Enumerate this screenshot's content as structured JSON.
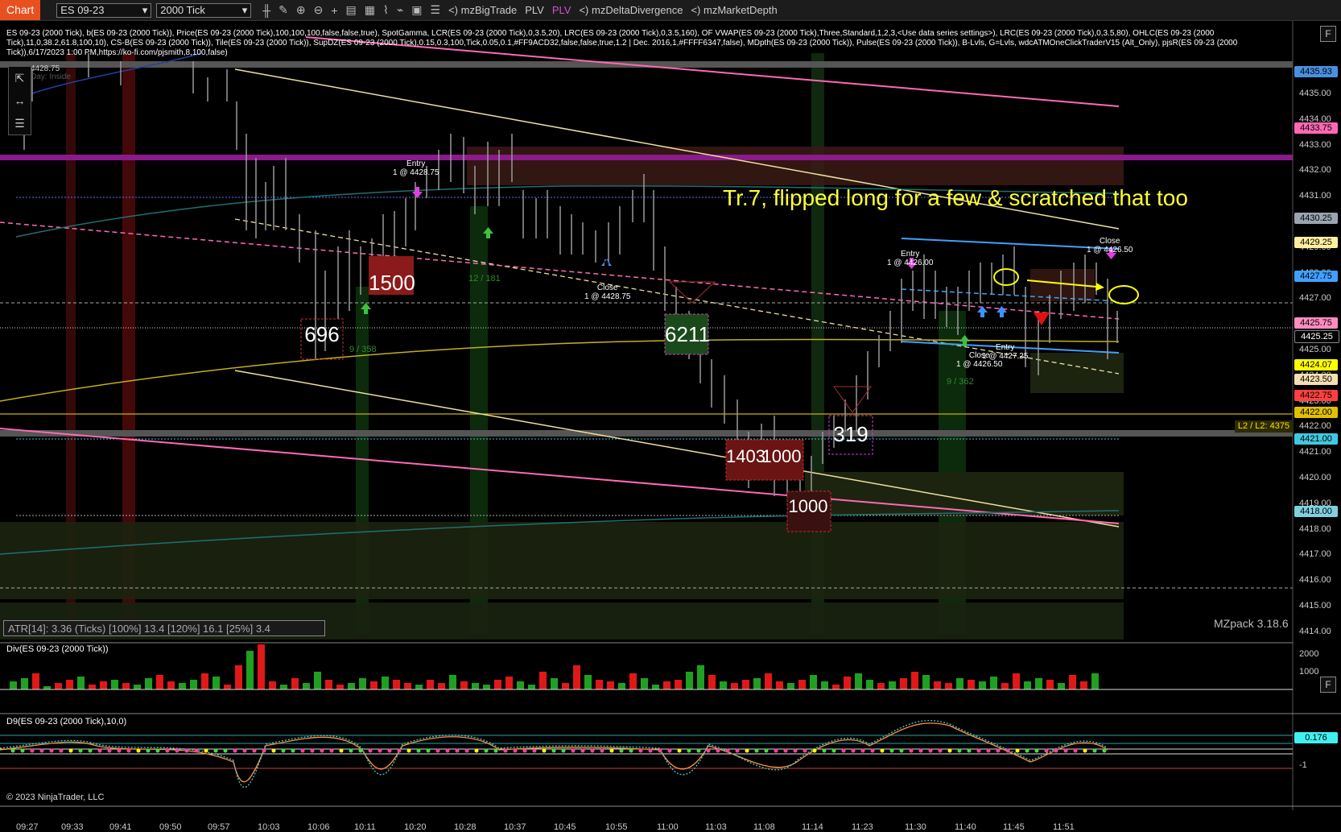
{
  "toolbar": {
    "chart_tab": "Chart",
    "instrument": "ES 09-23",
    "interval": "2000 Tick",
    "items": [
      "mzBigTrade",
      "PLV",
      "PLV",
      "mzDeltaDivergence",
      "mzMarketDepth"
    ]
  },
  "indicators_text": "ES 09-23 (2000 Tick), b(ES 09-23 (2000 Tick)), Price(ES 09-23 (2000 Tick),100,100,100,false,false,true), SpotGamma, LCR(ES 09-23 (2000 Tick),0,3.5,20), LRC(ES 09-23 (2000 Tick),0,3.5,160), OF VWAP(ES 09-23 (2000 Tick),Three,Standard,1,2,3,<Use data series settings>), LRC(ES 09-23 (2000 Tick),0,3.5,80), OHLC(ES 09-23 (2000 Tick),11,0,38.2,61.8,100,10), CS-B(ES 09-23 (2000 Tick)), Tile(ES 09-23 (2000 Tick)), SupDZ(ES 09-23 (2000 Tick),0.15,0.3,100,Tick,0.05,0.1,#FF9ACD32,false,false,true,1.2 | Dec. 2016,1,#FFFF6347,false), MDpth(ES 09-23 (2000 Tick)), Pulse(ES 09-23 (2000 Tick)), B-Lvls, G=Lvls, wdcATMOneClickTraderV15 (Alt_Only), pjsR(ES 09-23 (2000 Tick)),6/17/2023 1:00 PM,https://ko-fi.com/pjsmith,8,100,false)",
  "small_overlay": [
    "4428.75",
    "Day: Inside"
  ],
  "annotation": "Tr.7, flipped long for a few & scratched that too",
  "trades": [
    {
      "label": "Entry",
      "detail": "1 @ 4428.75"
    },
    {
      "label": "Close",
      "detail": "1 @ 4428.75"
    },
    {
      "label": "Entry",
      "detail": "1 @ 4426.00"
    },
    {
      "label": "Close",
      "detail": "1 @ 4426.50"
    },
    {
      "label": "Entry",
      "detail": "1 @ 4427.25"
    },
    {
      "label": "Close",
      "detail": "1 @ 4426.50"
    }
  ],
  "big_trades": [
    "1500",
    "696",
    "6211",
    "319",
    "1403",
    "1000",
    "1000"
  ],
  "green_labels": [
    "12 / 181",
    "9 / 358",
    "9 / 362"
  ],
  "atr": "ATR[14]: 3.36 (Ticks) [100%] 13.4  [120%] 16.1  [25%] 3.4",
  "mzpack": "MZpack 3.18.6",
  "l2_label": "L2 / L2: 4375",
  "price_axis": [
    "4435.00",
    "4434.00",
    "4433.00",
    "4432.00",
    "4431.00",
    "4430.00",
    "4429.00",
    "4428.00",
    "4427.00",
    "4426.00",
    "4425.00",
    "4424.00",
    "4423.00",
    "4422.00",
    "4421.00",
    "4420.00",
    "4419.00",
    "4418.00",
    "4417.00",
    "4416.00",
    "4415.00",
    "4414.00"
  ],
  "price_tags": [
    {
      "value": "4435.93",
      "color": "#4a90e2"
    },
    {
      "value": "4433.75",
      "color": "#ff69b4"
    },
    {
      "value": "4430.25",
      "color": "#9aa4b0"
    },
    {
      "value": "4429.25",
      "color": "#fff0a0"
    },
    {
      "value": "4427.75",
      "color": "#40a0ff"
    },
    {
      "value": "4425.75",
      "color": "#ff8cc0"
    },
    {
      "value": "4425.25",
      "color": "#000000"
    },
    {
      "value": "4424.07",
      "color": "#ffff00"
    },
    {
      "value": "4423.50",
      "color": "#f5deb3"
    },
    {
      "value": "4422.75",
      "color": "#ff4040"
    },
    {
      "value": "4422.00",
      "color": "#e0c000"
    },
    {
      "value": "4421.00",
      "color": "#40c8e0"
    },
    {
      "value": "4418.00",
      "color": "#80d0e0"
    }
  ],
  "div_panel": {
    "title": "Div(ES 09-23 (2000 Tick))",
    "axis": [
      "2000",
      "1000"
    ]
  },
  "d9_panel": {
    "title": "D9(ES 09-23 (2000 Tick),10,0)",
    "value": "0.176",
    "axis": [
      "-1"
    ]
  },
  "copyright": "© 2023 NinjaTrader, LLC",
  "time_axis": [
    "09:27",
    "09:33",
    "09:41",
    "09:50",
    "09:57",
    "10:03",
    "10:06",
    "10:11",
    "10:20",
    "10:28",
    "10:37",
    "10:45",
    "10:55",
    "11:00",
    "11:03",
    "11:08",
    "11:14",
    "11:23",
    "11:30",
    "11:40",
    "11:45",
    "11:51"
  ],
  "f_button": "F"
}
